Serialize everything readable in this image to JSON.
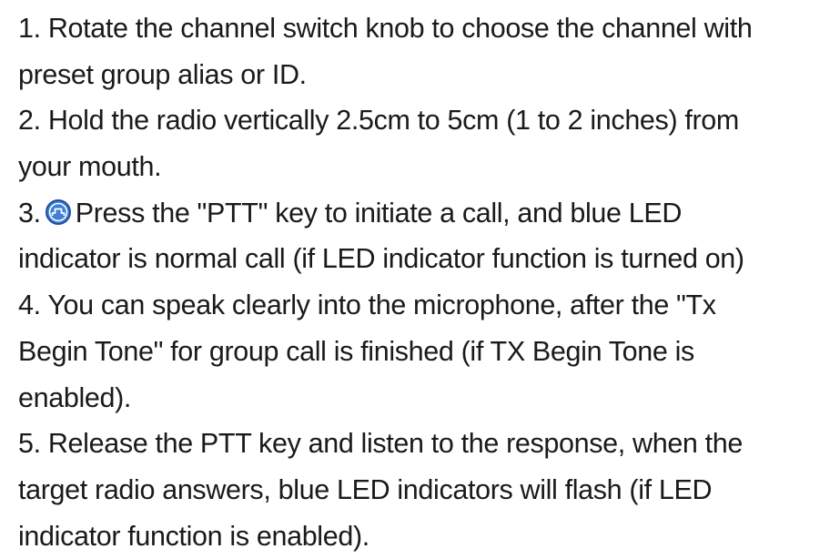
{
  "steps": [
    {
      "number": "1.",
      "lines": [
        "Rotate the channel switch knob to choose the channel with",
        "preset group alias or ID."
      ]
    },
    {
      "number": "2.",
      "lines": [
        "Hold the radio vertically 2.5cm to 5cm (1 to 2 inches) from",
        "your mouth."
      ]
    },
    {
      "number": "3.",
      "icon": "ptt-key-icon",
      "lines": [
        "Press the \"PTT\" key to initiate a call, and blue LED",
        "indicator is normal call (if LED indicator function is turned on)"
      ]
    },
    {
      "number": "4.",
      "lines": [
        "You can speak clearly into the microphone, after the \"Tx",
        "Begin Tone\" for group call is finished (if TX Begin Tone is",
        "enabled)."
      ]
    },
    {
      "number": "5.",
      "lines": [
        "Release the PTT key and listen to the response, when the",
        "target radio answers, blue LED indicators will flash (if LED",
        "indicator function is enabled)."
      ]
    }
  ],
  "colors": {
    "text": "#1a1a1a",
    "icon_fill": "#3f7fd6",
    "icon_stroke": "#1f4f9e"
  }
}
